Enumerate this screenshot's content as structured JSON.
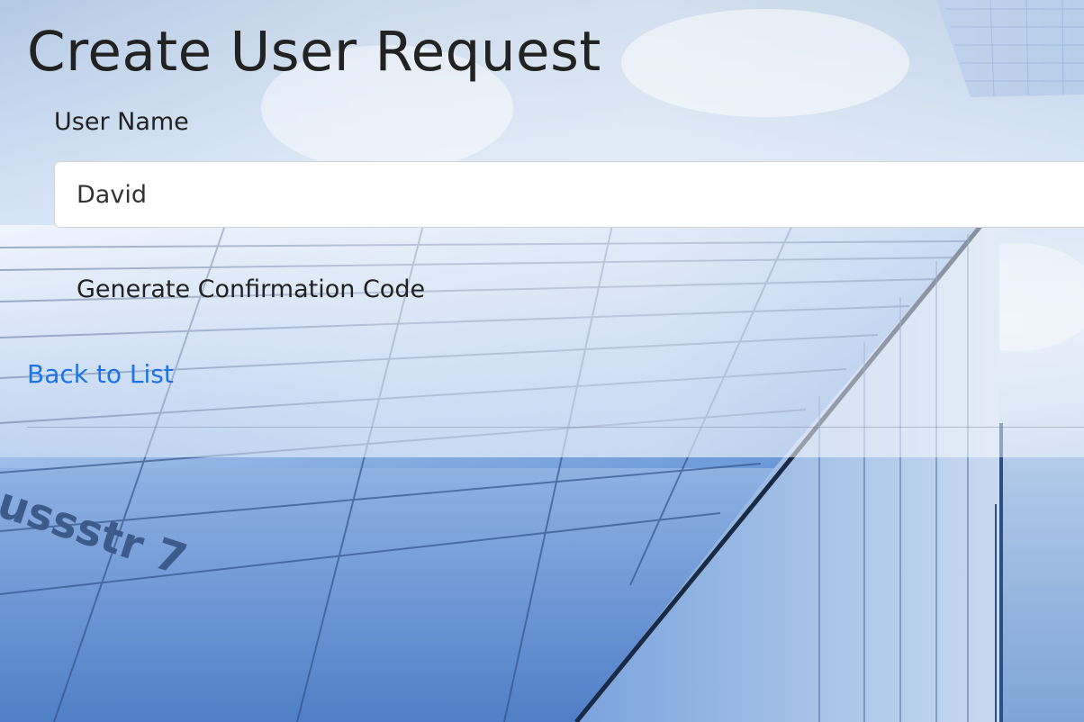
{
  "page": {
    "title": "Create User Request"
  },
  "form": {
    "user_name_label": "User Name",
    "user_name_value": "David",
    "submit_label": "Generate Confirmation Code"
  },
  "links": {
    "back_label": "Back to List"
  },
  "background": {
    "image_text": "ussstr 7",
    "sky_color": "#b9d2ee",
    "glass_color": "#5a8fd6",
    "link_color": "#1a73e8"
  }
}
